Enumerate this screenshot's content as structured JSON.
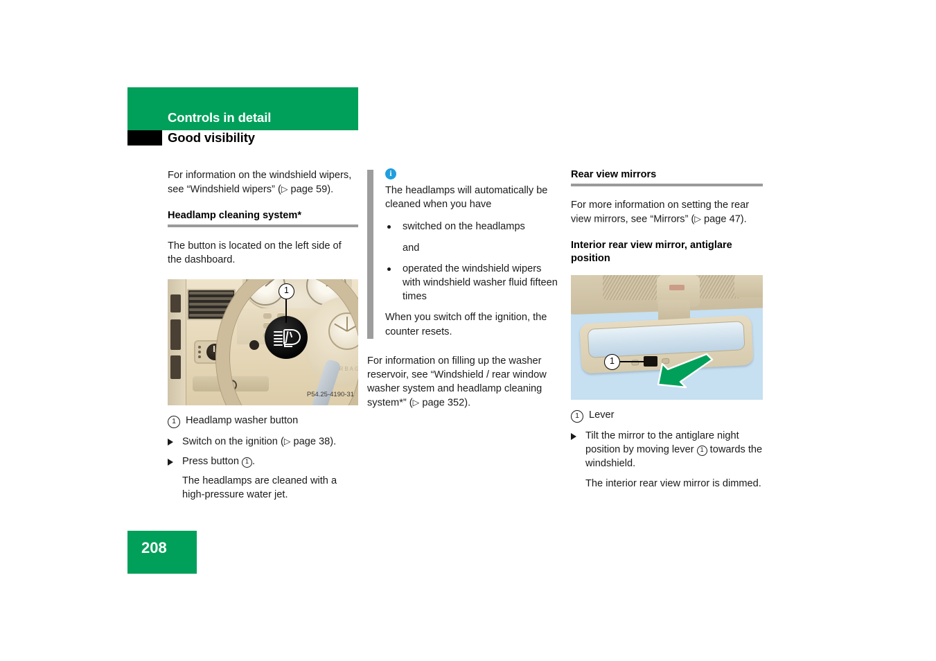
{
  "header": {
    "chapter_title": "Controls in detail",
    "section_title": "Good visibility"
  },
  "footer": {
    "page_number": "208"
  },
  "left_column": {
    "intro_paragraph": "For information on the windshield wipers, see “Windshield wipers” (▷ page 59).",
    "heading": "Headlamp cleaning system*",
    "body_paragraph": "The button is located on the left side of the dashboard.",
    "figure": {
      "callout_number": "1",
      "photo_code": "P54.25-4190-31",
      "airbag_text": "AIRBAG",
      "alt": "Mercedes dashboard with steering wheel and headlamp washer button"
    },
    "caption_number": "1",
    "caption_text": "Headlamp washer button",
    "steps": [
      {
        "text_before": "Switch on the ignition (▷ page 38)."
      },
      {
        "text_before": "Press button ",
        "inline_number": "1",
        "text_after": "."
      }
    ],
    "result_text": "The headlamps are cleaned with a high-pressure water jet."
  },
  "middle_column": {
    "note": {
      "icon": "info-icon",
      "intro": "The headlamps will automatically be cleaned when you have",
      "bullets": [
        "switched on the headlamps",
        "operated the windshield wipers with windshield washer fluid fifteen times"
      ],
      "conjunction": "and",
      "closing": "When you switch off the ignition, the counter resets."
    },
    "body_paragraph": "For information on filling up the washer reservoir, see “Windshield / rear window washer system and headlamp cleaning system*” (▷ page 352)."
  },
  "right_column": {
    "heading": "Rear view mirrors",
    "body_paragraph": "For more information on setting the rear view mirrors, see “Mirrors” (▷ page 47).",
    "subheading": "Interior rear view mirror, antiglare position",
    "figure": {
      "callout_number": "1",
      "alt": "Interior rear view mirror with antiglare lever and green motion arrow"
    },
    "caption_number": "1",
    "caption_text": "Lever",
    "step": {
      "text_before": "Tilt the mirror to the antiglare night position by moving lever ",
      "inline_number": "1",
      "text_after": " towards the windshield."
    },
    "result_text": "The interior rear view mirror is dimmed."
  },
  "colors": {
    "brand_green": "#00a05a",
    "note_icon_blue": "#1f9fdd",
    "rule_gray": "#9a9a9a",
    "mirror_figure_bg": "#c6dff1",
    "arrow_green": "#00a05a"
  }
}
